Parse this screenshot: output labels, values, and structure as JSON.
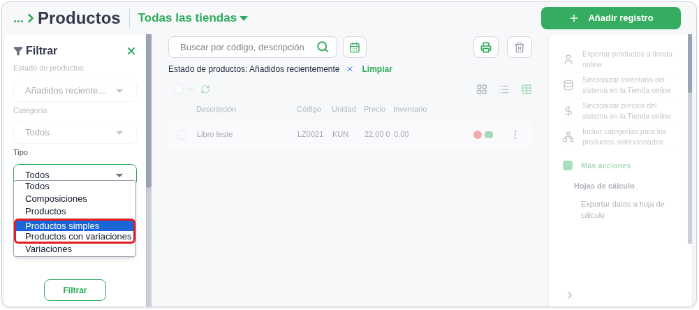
{
  "header": {
    "breadcrumb": "...",
    "title": "Productos",
    "store_selector": "Todas las tiendas",
    "add_button": "Añadir registro"
  },
  "filter_panel": {
    "title": "Filtrar",
    "fields": [
      {
        "label": "Estado de productos",
        "value": "Añadidos reciente...",
        "faded": true,
        "focused": false
      },
      {
        "label": "Categoría",
        "value": "Todos",
        "faded": true,
        "focused": false
      },
      {
        "label": "Tipo",
        "value": "Todos",
        "faded": false,
        "focused": true
      }
    ],
    "dropdown": [
      {
        "label": "Todos",
        "selected": false,
        "marked": false
      },
      {
        "label": "Composiciones",
        "selected": false,
        "marked": false
      },
      {
        "label": "Productos",
        "selected": false,
        "marked": false
      },
      {
        "label": "Productos simples",
        "selected": true,
        "marked": true
      },
      {
        "label": "Productos con variaciones",
        "selected": false,
        "marked": true
      },
      {
        "label": "Variaciones",
        "selected": false,
        "marked": false
      }
    ],
    "button": "Filtrar"
  },
  "search": {
    "placeholder": "Buscar por código, descripción"
  },
  "active_filter": {
    "text": "Estado de productos: Añadidos recientemente",
    "clear": "Limpiar"
  },
  "table": {
    "select_all_checked": false,
    "columns": [
      "Descripción",
      "Código",
      "Unidad",
      "Precio",
      "Inventario"
    ],
    "rows": [
      {
        "checked": false,
        "cells": [
          "Libro teste",
          "LZ0021",
          "KUN",
          "22.00 0",
          "0.00"
        ]
      }
    ]
  },
  "actions_panel": {
    "items": [
      {
        "kind": "user",
        "label": "Exportar productos a tienda online"
      },
      {
        "kind": "sync",
        "label": "Sincronizar inventario del sistema en la Tienda online"
      },
      {
        "kind": "price",
        "label": "Sincronizar precios del sistema en la Tienda online"
      },
      {
        "kind": "tree",
        "label": "Incluir categorías para los productos seleccionados"
      }
    ],
    "more_title": "Más acciones",
    "group": "Hojas de cálculo",
    "group_items": [
      "Exportar datos a hoja de cálculo"
    ]
  }
}
